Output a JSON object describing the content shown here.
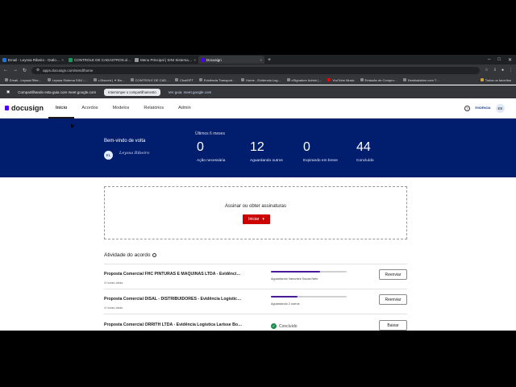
{
  "browser": {
    "tabs": [
      {
        "label": "Email - Leyssa Ribeiro - Outlo…",
        "active": false
      },
      {
        "label": "CONTROLE DE CADASTROS.xl…",
        "active": false
      },
      {
        "label": "Menu Principal | SINI Sistema…",
        "active": false
      },
      {
        "label": "Docusign",
        "active": true
      }
    ],
    "new_tab": "+",
    "url": "apps.docusign.com/send/home",
    "bookmarks": [
      "Email - Leyssa Ribe…",
      "Leyssa Sistema SINI ↓…",
      "r-Discord | ✦ Ba…",
      "CONTROLE DE CAD…",
      "ChatGPT",
      "Evidência Transport…",
      "Home - Evidencia Log…",
      "eSignature Admin |…",
      "YouTube Music",
      "Emissão de Compro…",
      "Destinatários com T…"
    ],
    "bookmarks_right": "Todos os favoritos"
  },
  "share": {
    "text": "Compartilhando esta guia com meet.google.com",
    "stop_label": "Interromper o compartilhamento",
    "view_label": "Ver guia: meet.google.com"
  },
  "header": {
    "logo": "docusign",
    "nav": [
      {
        "label": "Início",
        "active": true
      },
      {
        "label": "Acordos",
        "active": false
      },
      {
        "label": "Modelos",
        "active": false
      },
      {
        "label": "Relatórios",
        "active": false
      },
      {
        "label": "Admin",
        "active": false
      }
    ],
    "help": "?",
    "org_logo": "EVIDÊNCIA",
    "avatar": "EE"
  },
  "banner": {
    "welcome": "Bem-vindo de volta",
    "avatar": "EL",
    "signature": "Leyssa Ribeiro",
    "period": "Últimos 6 meses",
    "stats": [
      {
        "value": "0",
        "label": "Ação necessária"
      },
      {
        "value": "12",
        "label": "Aguardando outros"
      },
      {
        "value": "0",
        "label": "Expirando em breve"
      },
      {
        "value": "44",
        "label": "Concluído"
      }
    ]
  },
  "sign": {
    "title": "Assinar ou obter assinaturas",
    "start_label": "Iniciar",
    "caret": "▾"
  },
  "activity": {
    "title": "Atividade do acordo",
    "info": "i",
    "rows": [
      {
        "name": "Proposta Comercial FHC PINTURAS E MAQUINAS LTDA - Evidênci…",
        "time": "4 horas atrás",
        "progress": 0.65,
        "status": "Aguardando Vanuntes Souza Neto",
        "action": "Reenviar",
        "completed": false
      },
      {
        "name": "Proposta Comercial DISAL - DISTRIBUIDORES - Evidência Logístic…",
        "time": "4 horas atrás",
        "progress": 0.35,
        "status": "Aguardando 2 outros",
        "action": "Reenviar",
        "completed": false
      },
      {
        "name": "Proposta Comercial ORRITH LTDA - Evidência Logística Larisse Bo…",
        "time": "",
        "progress": 1,
        "status": "Concluído",
        "action": "Baixar",
        "completed": true
      }
    ]
  },
  "colors": {
    "banner": "#011e6e",
    "primary_button": "#cc0000",
    "progress": "#4a1a9a",
    "brand": "#4c00ff"
  }
}
